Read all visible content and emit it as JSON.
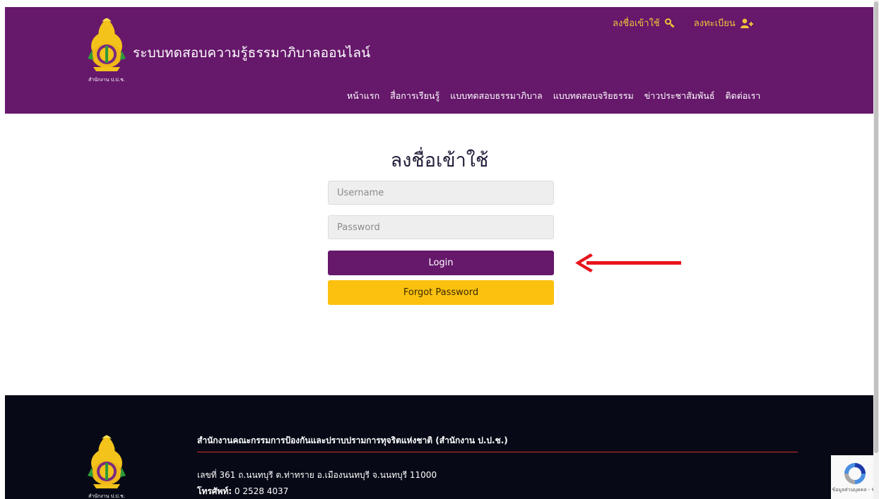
{
  "header": {
    "site_title": "ระบบทดสอบความรู้ธรรมาภิบาลออนไลน์",
    "logo_caption": "สำนักงาน ป.ป.ช.",
    "login_link": "ลงชื่อเข้าใช้",
    "register_link": "ลงทะเบียน",
    "nav": [
      "หน้าแรก",
      "สื่อการเรียนรู้",
      "แบบทดสอบธรรมาภิบาล",
      "แบบทดสอบจริยธรรม",
      "ข่าวประชาสัมพันธ์",
      "ติดต่อเรา"
    ]
  },
  "login": {
    "title": "ลงชื่อเข้าใช้",
    "username_placeholder": "Username",
    "password_placeholder": "Password",
    "login_button": "Login",
    "forgot_button": "Forgot Password"
  },
  "footer": {
    "org_name": "สำนักงานคณะกรรมการป้องกันและปราบปรามการทุจริตแห่งชาติ (สำนักงาน ป.ป.ช.)",
    "address": "เลขที่ 361 ถ.นนทบุรี ต.ท่าทราย อ.เมืองนนทบุรี จ.นนทบุรี 11000",
    "phone_label": "โทรศัพท์:",
    "phone_value": "0 2528 4037",
    "logo_caption": "สำนักงาน ป.ป.ช."
  },
  "recaptcha": {
    "text": "ข้อมูลส่วนบุคคล - ข้อ"
  },
  "colors": {
    "brand_purple": "#66186b",
    "accent_gold": "#fcc10f",
    "footer_dark": "#070a16",
    "annotation_red": "#e8141b"
  },
  "icons": {
    "login_link": "key-icon",
    "register_link": "user-plus-icon",
    "annotation": "red-arrow-icon"
  }
}
